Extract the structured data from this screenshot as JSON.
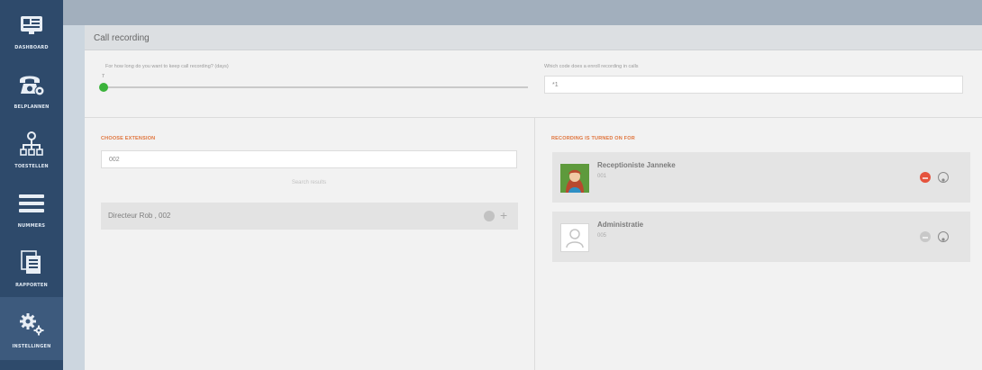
{
  "sidebar": {
    "items": [
      {
        "label": "DASHBOARD",
        "icon": "dashboard-icon"
      },
      {
        "label": "BELPLANNEN",
        "icon": "phone-settings-icon"
      },
      {
        "label": "TOESTELLEN",
        "icon": "org-tree-icon"
      },
      {
        "label": "NUMMERS",
        "icon": "menu-lines-icon"
      },
      {
        "label": "RAPPORTEN",
        "icon": "documents-icon"
      },
      {
        "label": "INSTELLINGEN",
        "icon": "gears-icon",
        "active": true
      }
    ]
  },
  "panel": {
    "title": "Call recording",
    "retention_label": "For how long do you want to keep call recording? (days)",
    "retention_value": "7",
    "retention_fraction": 0.0,
    "dial_label": "Which code does a enroll recording in calls",
    "dial_value": "*1"
  },
  "left": {
    "section_title": "CHOOSE EXTENSION",
    "search_value": "002",
    "search_results_text": "Search results",
    "extension_row": "Directeur Rob , 002"
  },
  "right": {
    "section_title": "RECORDING IS TURNED ON FOR",
    "cards": [
      {
        "name": "Receptioniste Janneke",
        "ext": "001",
        "avatar": "woman-avatar-icon"
      },
      {
        "name": "Administratie",
        "ext": "005",
        "avatar": "person-placeholder-icon"
      }
    ]
  },
  "colors": {
    "sidebar_bg": "#2e4a6b",
    "accent_orange": "#e0743c",
    "slider_green": "#3bb33b",
    "remove_red": "#e5533d"
  }
}
